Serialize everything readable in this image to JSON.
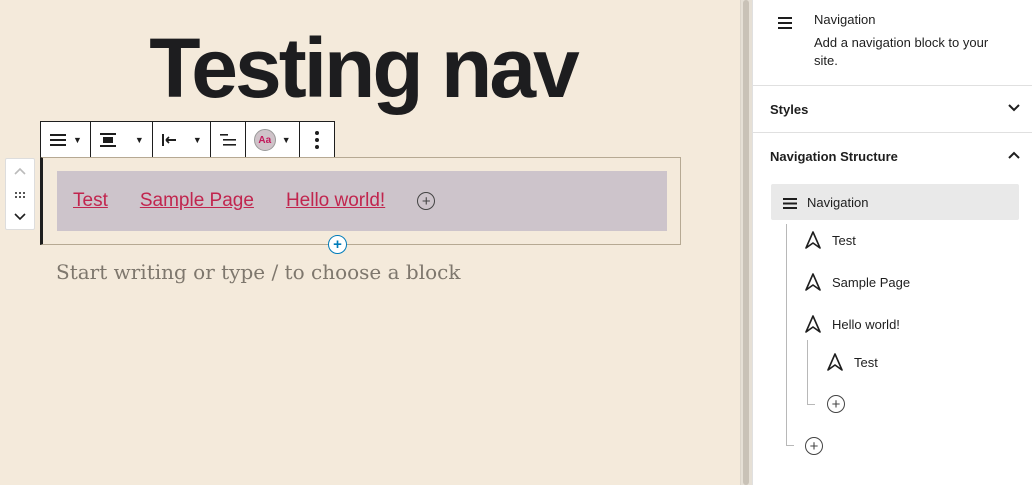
{
  "editor": {
    "page_title": "Testing nav",
    "placeholder": "Start writing or type / to choose a block",
    "nav_links": [
      "Test",
      "Sample Page",
      "Hello world!"
    ]
  },
  "sidebar": {
    "block_title": "Navigation",
    "block_description": "Add a navigation block to your site.",
    "styles_label": "Styles",
    "structure_label": "Navigation Structure",
    "tree": {
      "root": "Navigation",
      "items": [
        "Test",
        "Sample Page",
        "Hello world!"
      ],
      "child": "Test"
    }
  },
  "colors": {
    "link": "#c1254e",
    "canvas_bg": "#f4eadb",
    "nav_bg": "#cdc4cb",
    "accent_blue": "#007cba"
  },
  "icons": [
    "menu-icon",
    "justify-icon",
    "align-left-icon",
    "list-icon",
    "text-color-icon",
    "more-icon",
    "chevron-up-icon",
    "drag-icon",
    "chevron-down-icon",
    "plus-icon",
    "navigation-link-icon"
  ]
}
